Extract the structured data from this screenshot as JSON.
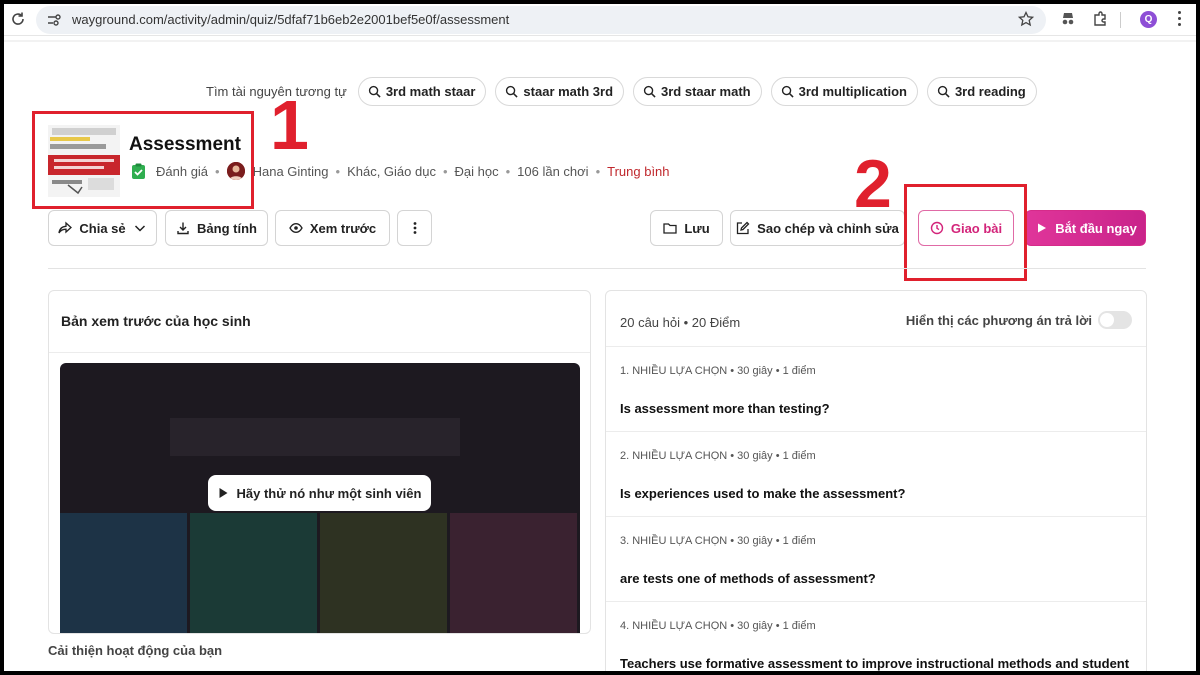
{
  "browser": {
    "url": "wayground.com/activity/admin/quiz/5dfaf71b6eb2e2001bef5e0f/assessment",
    "profile_initial": "Q"
  },
  "related": {
    "label": "Tìm tài nguyên tương tự",
    "chips": [
      "3rd math staar",
      "staar math 3rd",
      "3rd staar math",
      "3rd multiplication",
      "3rd reading"
    ]
  },
  "quiz": {
    "title": "Assessment",
    "type": "Đánh giá",
    "author": "Hana Ginting",
    "subjects": "Khác, Giáo dục",
    "grade": "Đại học",
    "plays": "106 lần chơi",
    "difficulty": "Trung bình",
    "difficulty_color": "#c0282d"
  },
  "annotations": {
    "one": "1",
    "two": "2",
    "color": "#e0202d"
  },
  "actions": {
    "share": "Chia sẻ",
    "spreadsheet": "Bảng tính",
    "preview": "Xem trước",
    "save": "Lưu",
    "copy_edit": "Sao chép và chỉnh sửa",
    "assign": "Giao bài",
    "start": "Bắt đầu ngay"
  },
  "student_preview": {
    "title": "Bản xem trước của học sinh",
    "try_button": "Hãy thử nó như một sinh viên"
  },
  "improve_label": "Cải thiện hoạt động của bạn",
  "questions_panel": {
    "count": "20 câu hỏi",
    "points": "20 Điểm",
    "toggle_label": "Hiển thị các phương án trả lời",
    "toggle_on": false,
    "items": [
      {
        "meta": "1. NHIỀU LỰA CHỌN",
        "time": "30 giây",
        "points": "1 điểm",
        "text": "Is assessment more than testing?"
      },
      {
        "meta": "2. NHIỀU LỰA CHỌN",
        "time": "30 giây",
        "points": "1 điểm",
        "text": "Is experiences used to make the assessment?"
      },
      {
        "meta": "3. NHIỀU LỰA CHỌN",
        "time": "30 giây",
        "points": "1 điểm",
        "text": "are tests one of methods of assessment?"
      },
      {
        "meta": "4. NHIỀU LỰA CHỌN",
        "time": "30 giây",
        "points": "1 điểm",
        "text": "Teachers use formative assessment to improve instructional methods and student"
      }
    ]
  },
  "colors": {
    "accent": "#d62b8a",
    "assign": "#d3247a"
  }
}
